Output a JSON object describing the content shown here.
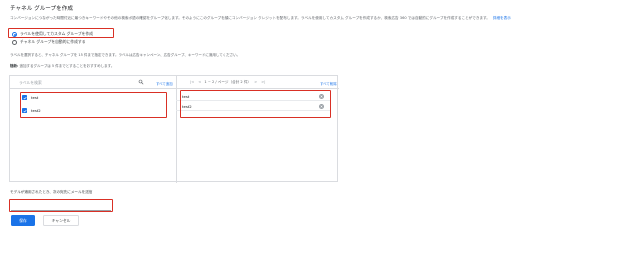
{
  "page": {
    "title": "チャネル グループを作成",
    "description": "コンバージョンにつながった時間付近に最つきキーワードやその他の検索ボ語の確認をグループ化します。そのようにこのグループを顔にコンバージョン クレジットを配布します。ラベルを使用してカスタム グループを作成するか、検索広告 360 では自動的にグループを作成することができます。",
    "description_link": "詳細を表示"
  },
  "options": [
    {
      "label": "ラベルを使用してカスタム グループを作成",
      "selected": true
    },
    {
      "label": "チャネル グループを自動的に作成する",
      "selected": false
    }
  ],
  "hint1": "ラベルを選択すると、チャネル グループを 15 件まで指定できます。ラベルは広告キャンペーン、広告グループ、キーワードに適用してください。",
  "hint2_bold": "随新:",
  "hint2": "追加するグループは 5 件までとすることをおすすめします。",
  "picker": {
    "search_placeholder": "ラベルを検索",
    "add_all": "すべて追加",
    "pager": "1 ~ 2 / ページ（合計 2 件）",
    "pager_prev": "|<",
    "pager_back": "<",
    "pager_next": ">",
    "pager_last": ">|",
    "remove_all": "すべて削除",
    "available": [
      {
        "label": "test",
        "checked": true
      },
      {
        "label": "test2",
        "checked": true
      }
    ],
    "selected": [
      {
        "label": "test"
      },
      {
        "label": "test2"
      }
    ]
  },
  "email": {
    "label": "モデルが適用されたとき、次の宛先にメールを送信",
    "value": ""
  },
  "buttons": {
    "save": "保存",
    "cancel": "キャンセル"
  },
  "colors": {
    "accent": "#1a73e8",
    "highlight": "#d93025"
  }
}
